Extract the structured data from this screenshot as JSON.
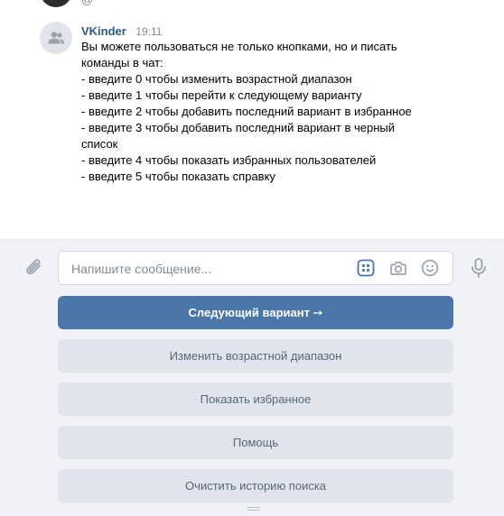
{
  "message": {
    "author": "VKinder",
    "time": "19:11",
    "lines": [
      "Вы можете пользоваться не только кнопками, но и писать",
      "команды в чат:",
      "- введите 0 чтобы изменить возрастной диапазон",
      "- введите 1 чтобы перейти к следующему варианту",
      "- введите 2 чтобы добавить последний вариант в избранное",
      "- введите 3 чтобы добавить последний вариант в черный",
      "список",
      "- введите 4 чтобы показать избранных пользователей",
      "- введите 5 чтобы показать справку"
    ]
  },
  "composer": {
    "placeholder": "Напишите сообщение...",
    "value": ""
  },
  "keyboard": {
    "next": "Следующий вариант ➙",
    "change_age": "Изменить возрастной диапазон",
    "show_favorites": "Показать избранное",
    "help": "Помощь",
    "clear_history": "Очистить историю поиска"
  },
  "colors": {
    "accent": "#4a76a8",
    "author": "#2a5885",
    "secondary_button": "#e1e5eb",
    "composer_bg": "#f0f2f5"
  },
  "icons": {
    "attach": "paperclip-icon",
    "bot_keyboard": "bot-keyboard-icon",
    "camera": "camera-icon",
    "emoji": "smile-icon",
    "microphone": "microphone-icon",
    "avatar": "group-avatar-icon"
  }
}
